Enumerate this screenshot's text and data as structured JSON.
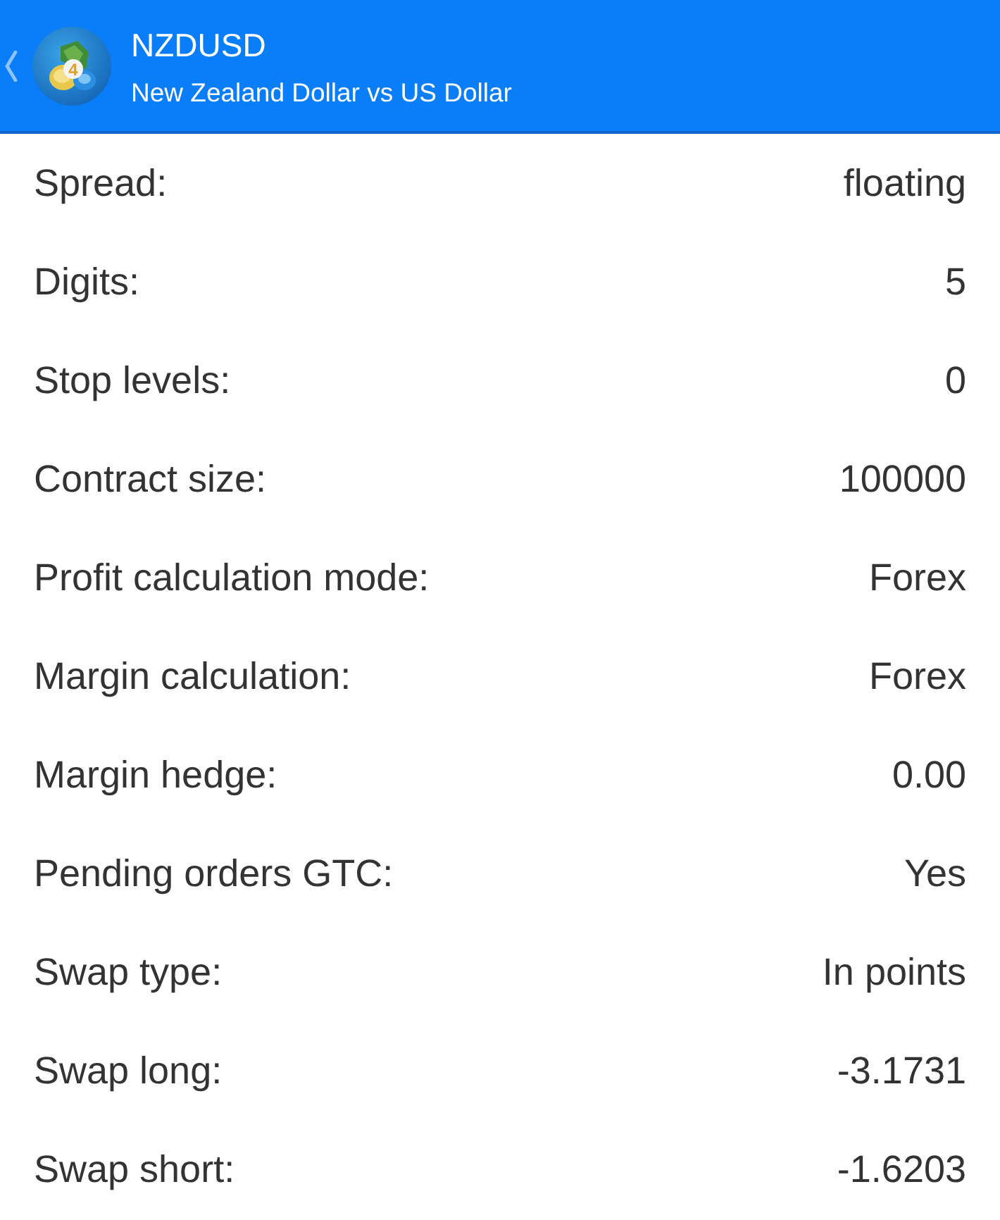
{
  "header": {
    "symbol": "NZDUSD",
    "description": "New Zealand Dollar vs US Dollar",
    "logo_text": "4"
  },
  "properties": [
    {
      "label": "Spread:",
      "value": "floating"
    },
    {
      "label": "Digits:",
      "value": "5"
    },
    {
      "label": "Stop levels:",
      "value": "0"
    },
    {
      "label": "Contract size:",
      "value": "100000"
    },
    {
      "label": "Profit calculation mode:",
      "value": "Forex"
    },
    {
      "label": "Margin calculation:",
      "value": "Forex"
    },
    {
      "label": "Margin hedge:",
      "value": "0.00"
    },
    {
      "label": "Pending orders GTC:",
      "value": "Yes"
    },
    {
      "label": "Swap type:",
      "value": "In points"
    },
    {
      "label": "Swap long:",
      "value": "-3.1731"
    },
    {
      "label": "Swap short:",
      "value": "-1.6203"
    }
  ]
}
